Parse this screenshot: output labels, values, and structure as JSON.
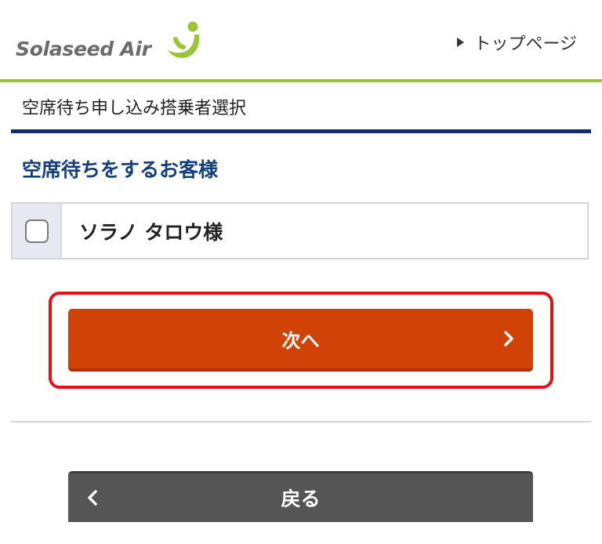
{
  "header": {
    "logo_text": "Solaseed Air",
    "top_link_label": "トップページ"
  },
  "page": {
    "title": "空席待ち申し込み搭乗者選択",
    "section_heading": "空席待ちをするお客様"
  },
  "passengers": [
    {
      "name": "ソラノ タロウ様",
      "checked": false
    }
  ],
  "actions": {
    "next_label": "次へ",
    "back_label": "戻る"
  },
  "colors": {
    "brand_green": "#9ac43a",
    "navy": "#0f2f6b",
    "heading_blue": "#13407a",
    "next_orange": "#d14206",
    "highlight_red": "#e3101a",
    "back_gray": "#555555"
  },
  "icons": {
    "logo_mark": "solaseed-logo-mark-icon",
    "top_link": "triangle-right-icon",
    "next": "chevron-right-icon",
    "back": "chevron-left-icon"
  }
}
